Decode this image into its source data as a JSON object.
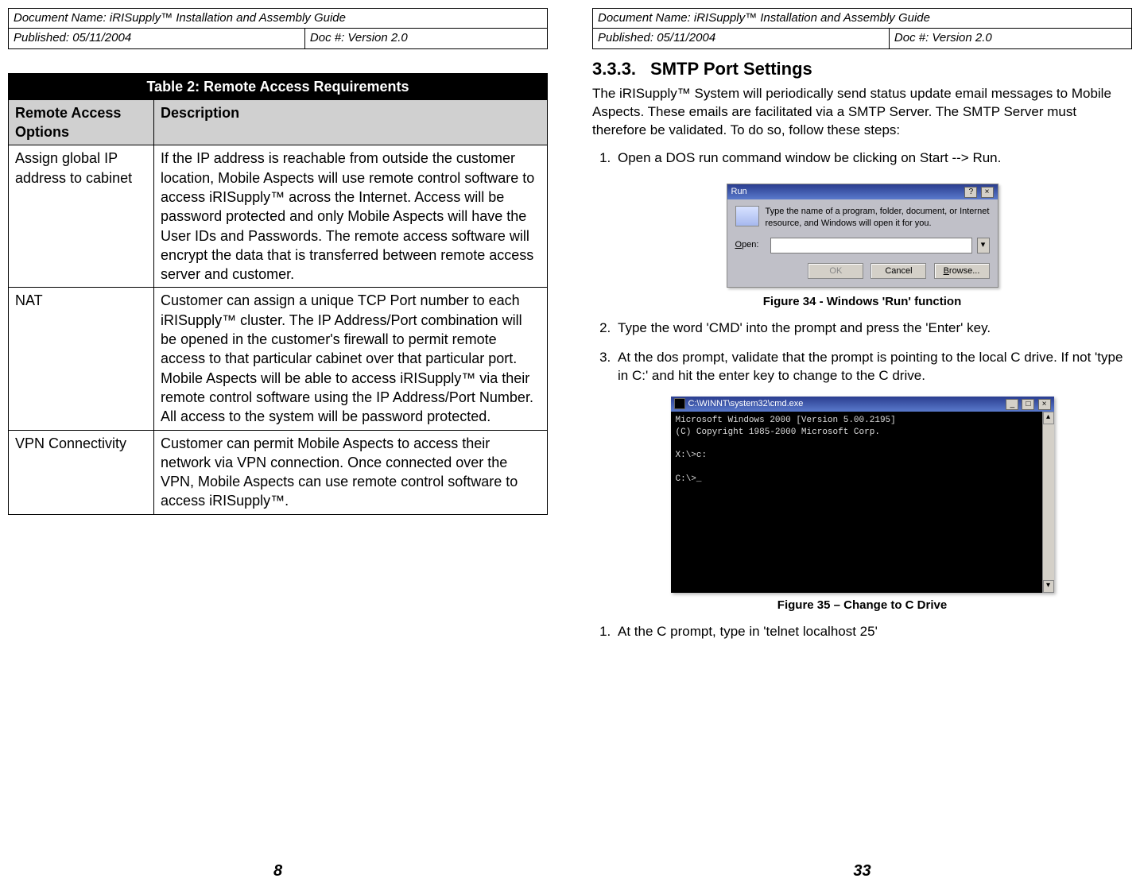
{
  "left": {
    "hdr": {
      "docname": "Document Name:  iRISupply™ Installation and Assembly Guide",
      "published": "Published:  05/11/2004",
      "docno": "Doc #:  Version 2.0"
    },
    "table": {
      "title": "Table 2: Remote Access Requirements",
      "col1": "Remote Access Options",
      "col2": "Description",
      "rows": [
        {
          "c1": "Assign global IP address to cabinet",
          "c2": "If the IP address is reachable from outside the customer location, Mobile Aspects will use remote control software to access iRISupply™ across the Internet.  Access will be password protected and only Mobile Aspects will have the User IDs and Passwords.  The remote access software will encrypt the data that is transferred between remote access server and customer."
        },
        {
          "c1": "NAT",
          "c2": "Customer can assign a unique TCP Port number to each iRISupply™ cluster.  The IP Address/Port combination will be opened in the customer's firewall to permit remote access to that particular cabinet over that particular port.  Mobile Aspects will be able to access iRISupply™ via their remote control software using the IP Address/Port Number.  All access to the system will be password protected."
        },
        {
          "c1": "VPN Connectivity",
          "c2": "Customer can permit Mobile Aspects to access their network via VPN connection.  Once connected over the VPN, Mobile Aspects can use remote control software to access iRISupply™."
        }
      ]
    },
    "pgno": "8"
  },
  "right": {
    "hdr": {
      "docname": "Document Name:  iRISupply™ Installation and Assembly Guide",
      "published": "Published:  05/11/2004",
      "docno": "Doc #:  Version 2.0"
    },
    "sectno": "3.3.3.",
    "secttitle": "SMTP Port Settings",
    "intro": "The iRISupply™ System will periodically send status update email messages to Mobile Aspects.  These emails are facilitated via a SMTP Server.  The SMTP Server must therefore be validated.  To do so, follow these steps:",
    "step1": "Open a DOS run command window be clicking on Start --> Run.",
    "fig34": "Figure 34 - Windows 'Run' function",
    "step2": "Type the word 'CMD' into the prompt and press the 'Enter' key.",
    "step3": "At the dos prompt, validate that the prompt is pointing to the local C drive.  If not 'type in C:' and hit the enter key to change to the C drive.",
    "fig35": "Figure 35 – Change to C Drive",
    "step_c": "At the C prompt, type in 'telnet localhost 25'",
    "run": {
      "title": "Run",
      "help": "?",
      "close": "×",
      "msg": "Type the name of a program, folder, document, or Internet resource, and Windows will open it for you.",
      "openlbl": "Open:",
      "ok": "OK",
      "cancel": "Cancel",
      "browse": "Browse..."
    },
    "cmd": {
      "title": "C:\\WINNT\\system32\\cmd.exe",
      "min": "_",
      "max": "□",
      "close": "×",
      "line1": "Microsoft Windows 2000 [Version 5.00.2195]",
      "line2": "(C) Copyright 1985-2000 Microsoft Corp.",
      "line3": "X:\\>c:",
      "line4": "C:\\>_",
      "up": "▴",
      "down": "▾"
    },
    "pgno": "33"
  }
}
